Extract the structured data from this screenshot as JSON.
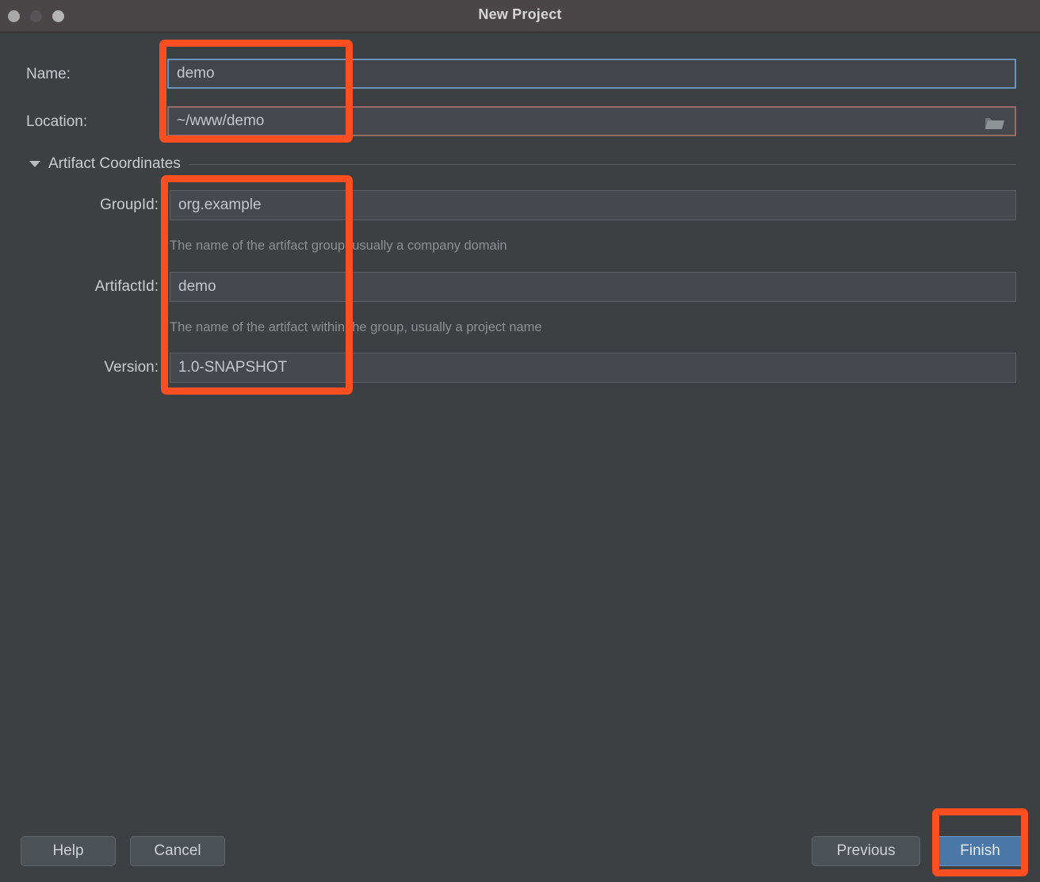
{
  "window": {
    "title": "New Project",
    "traffic_lights": [
      "close-button",
      "minimize-button",
      "zoom-button"
    ]
  },
  "form": {
    "name": {
      "label": "Name:",
      "value": "demo",
      "placeholder": "",
      "state": "focused"
    },
    "location": {
      "label": "Location:",
      "value": "~/www/demo",
      "placeholder": "",
      "state": "warning",
      "browse_icon": "folder-icon"
    }
  },
  "artifact_section": {
    "title": "Artifact Coordinates",
    "expanded": true,
    "disclosure_icon": "triangle-down-icon",
    "fields": [
      {
        "label": "GroupId:",
        "value": "org.example",
        "help": "The name of the artifact group, usually a company domain"
      },
      {
        "label": "ArtifactId:",
        "value": "demo",
        "help": "The name of the artifact within the group, usually a project name"
      },
      {
        "label": "Version:",
        "value": "1.0-SNAPSHOT",
        "help": ""
      }
    ]
  },
  "footer": {
    "help_label": "Help",
    "cancel_label": "Cancel",
    "previous_label": "Previous",
    "finish_label": "Finish"
  },
  "colors": {
    "titlebar_bg": "#4a4647",
    "dialog_bg": "#3c4043",
    "field_bg": "#45494d",
    "focus_border": "#6a94c0",
    "warning_border": "#9a6a68",
    "primary_button": "#4a77a8",
    "annotation": "#ff4f20",
    "text": "#c8cdd0",
    "help_text": "#8b9093"
  },
  "annotations": [
    {
      "name": "name-location-highlight",
      "color": "#ff4f20"
    },
    {
      "name": "artifact-fields-highlight",
      "color": "#ff4f20"
    },
    {
      "name": "finish-button-highlight",
      "color": "#ff4f20"
    }
  ]
}
